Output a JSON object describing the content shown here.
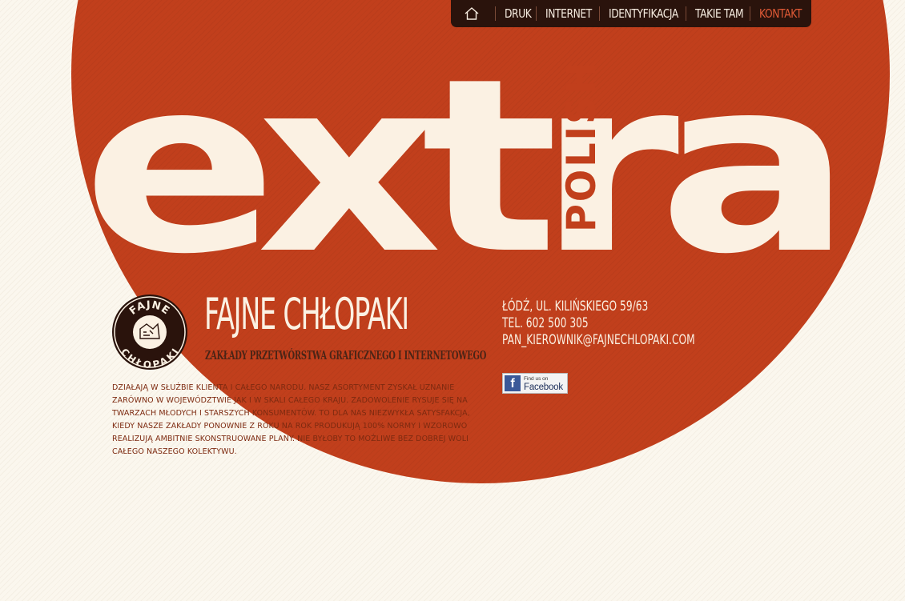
{
  "nav": {
    "home_icon": "home-icon",
    "items": [
      {
        "label": "DRUK",
        "active": false
      },
      {
        "label": "INTERNET",
        "active": false
      },
      {
        "label": "IDENTYFIKACJA",
        "active": false
      },
      {
        "label": "TAKIE TAM",
        "active": false
      },
      {
        "label": "KONTAKT",
        "active": true
      }
    ]
  },
  "hero": {
    "word": "extra",
    "side_word": "POLISH"
  },
  "emblem": {
    "top_text": "FAJNE",
    "bottom_text": "CHŁOPAKI"
  },
  "brand": {
    "name": "FAJNE CHŁOPAKI",
    "tagline": "ZAKŁADY PRZETWÓRSTWA GRAFICZNEGO I INTERNETOWEGO"
  },
  "contact": {
    "address": "ŁÓDŹ, UL. KILIŃSKIEGO 59/63",
    "phone": "TEL. 602 500 305",
    "email": "PAN_KIEROWNIK@FAJNECHLOPAKI.COM"
  },
  "facebook": {
    "small": "Find us on",
    "big": "Facebook"
  },
  "about": "DZIAŁAJĄ W SŁUŻBIE KLIENTA I CAŁEGO NARODU. NASZ ASORTYMENT ZYSKAŁ UZNANIE ZARÓWNO W WOJEWÓDZTWIE JAK I W SKALI CAŁEGO KRAJU. ZADOWOLENIE RYSUJE SIĘ NA TWARZACH MŁODYCH I STARSZYCH KONSUMENTÓW. TO DLA NAS NIEZWYKŁA SATYSFAKCJA, KIEDY NASZE ZAKŁADY PONOWNIE Z ROKU NA ROK PRODUKUJĄ 100% NORMY I WZOROWO REALIZUJĄ AMBITNIE SKONSTRUOWANE PLANY. NIE BYŁOBY TO MOŻLIWE BEZ DOBREJ WOLI CAŁEGO NASZEGO KOLEKTYWU.",
  "colors": {
    "circle": "#c13f1c",
    "cream": "#fbf1e3",
    "nav_bg": "#2a130c",
    "active": "#e05a36",
    "text_red": "#7d2a10"
  }
}
